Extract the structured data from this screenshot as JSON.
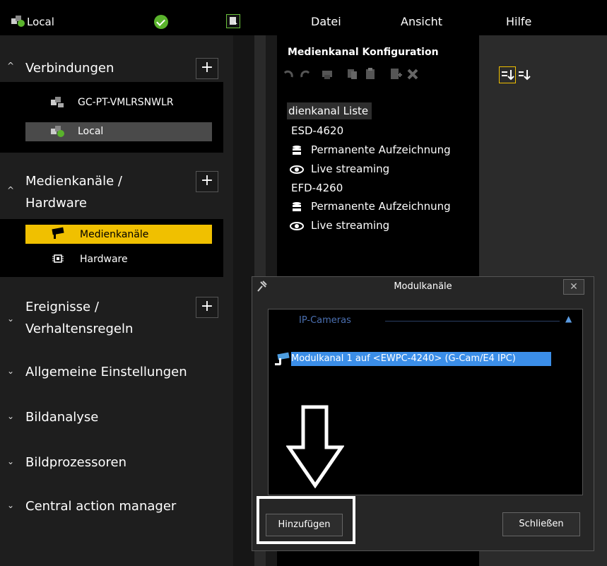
{
  "topbar": {
    "connection_name": "Local",
    "menus": [
      "Datei",
      "Ansicht",
      "Hilfe"
    ]
  },
  "sidebar": {
    "sections": [
      {
        "title": "Verbindungen",
        "items": [
          "GC-PT-VMLRSNWLR",
          "Local"
        ]
      },
      {
        "title_line1": "Medienkanäle /",
        "title_line2": "Hardware",
        "items": [
          "Medienkanäle",
          "Hardware"
        ]
      },
      {
        "title_line1": "Ereignisse /",
        "title_line2": "Verhaltensregeln"
      },
      {
        "title": "Allgemeine Einstellungen"
      },
      {
        "title": "Bildanalyse"
      },
      {
        "title": "Bildprozessoren"
      },
      {
        "title": "Central action manager"
      }
    ],
    "plus": "+"
  },
  "config": {
    "title": "Medienkanal Konfiguration",
    "list_header": "dienkanal Liste",
    "tree": [
      {
        "label": "ESD-4620"
      },
      {
        "label": "Permanente Aufzeichnung"
      },
      {
        "label": "Live streaming"
      },
      {
        "label": "EFD-4260"
      },
      {
        "label": "Permanente Aufzeichnung"
      },
      {
        "label": "Live streaming"
      }
    ]
  },
  "dialog": {
    "title": "Modulkanäle",
    "close": "✕",
    "group": "IP-Cameras",
    "item": "Modulkanal 1 auf <EWPC-4240> (G-Cam/E4 IPC)",
    "add_button": "Hinzufügen",
    "close_button": "Schließen"
  },
  "colors": {
    "accent": "#f0c000",
    "selection": "#3b8ee8",
    "ok": "#5ab32c"
  }
}
